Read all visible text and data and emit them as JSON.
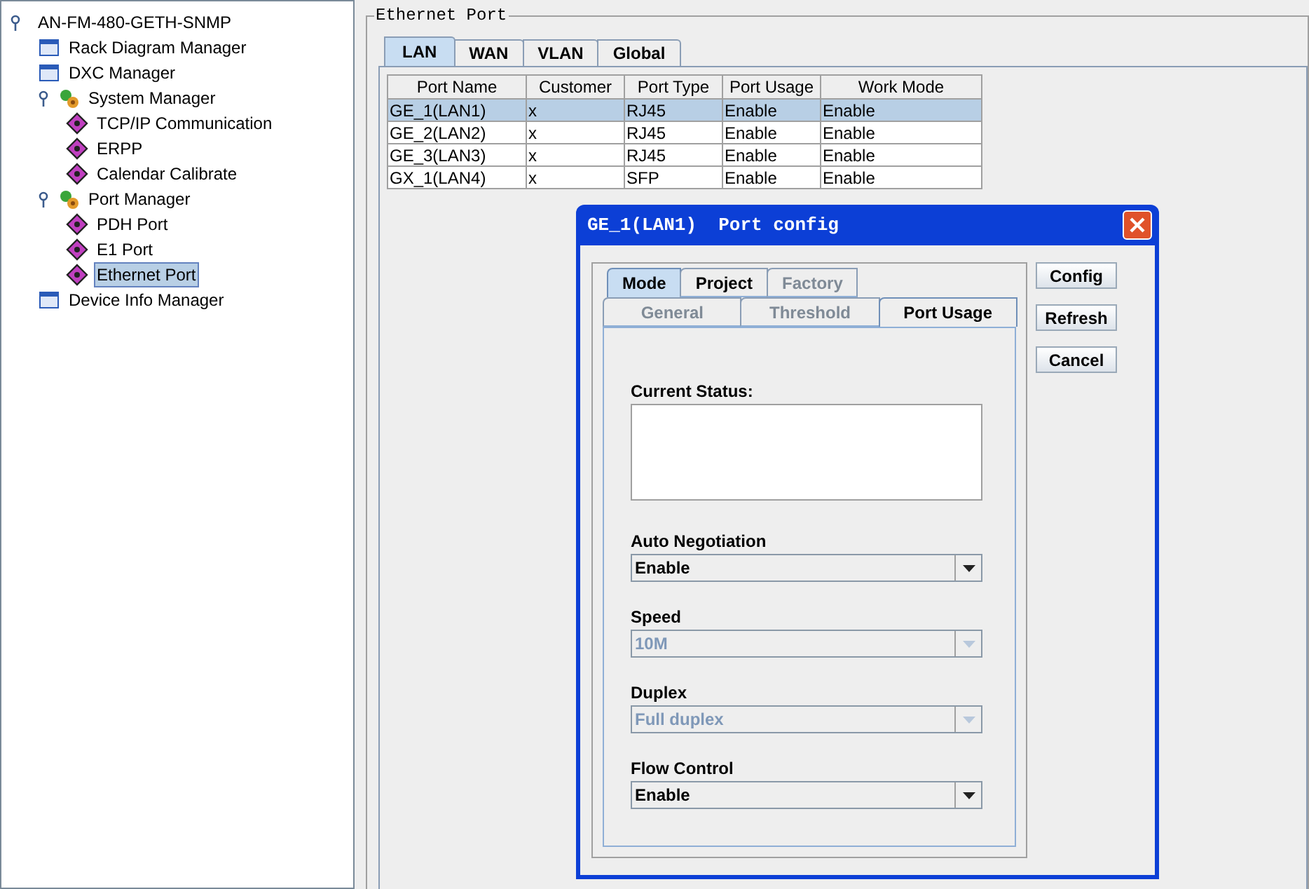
{
  "tree": {
    "label": "AN-FM-480-GETH-SNMP",
    "expanded": true,
    "selected": false,
    "children": [
      {
        "label": "Rack Diagram Manager",
        "selected": false
      },
      {
        "label": "DXC Manager",
        "selected": false
      },
      {
        "label": "System Manager",
        "expanded": true,
        "selected": false,
        "children": [
          {
            "label": "TCP/IP Communication",
            "selected": false
          },
          {
            "label": "ERPP",
            "selected": false
          },
          {
            "label": "Calendar Calibrate",
            "selected": false
          }
        ]
      },
      {
        "label": "Port Manager",
        "expanded": true,
        "selected": false,
        "children": [
          {
            "label": "PDH Port",
            "selected": false
          },
          {
            "label": "E1 Port",
            "selected": false
          },
          {
            "label": "Ethernet Port",
            "selected": true
          }
        ]
      },
      {
        "label": "Device Info Manager",
        "selected": false
      }
    ]
  },
  "panel": {
    "title": "Ethernet Port",
    "tabs": [
      {
        "label": "LAN",
        "selected": true
      },
      {
        "label": "WAN",
        "selected": false
      },
      {
        "label": "VLAN",
        "selected": false
      },
      {
        "label": "Global",
        "selected": false
      }
    ],
    "table": {
      "columns": [
        "Port Name",
        "Customer",
        "Port Type",
        "Port Usage",
        "Work Mode"
      ],
      "rows": [
        {
          "selected": true,
          "cells": [
            "GE_1(LAN1)",
            "x",
            "RJ45",
            "Enable",
            "Enable"
          ]
        },
        {
          "selected": false,
          "cells": [
            "GE_2(LAN2)",
            "x",
            "RJ45",
            "Enable",
            "Enable"
          ]
        },
        {
          "selected": false,
          "cells": [
            "GE_3(LAN3)",
            "x",
            "RJ45",
            "Enable",
            "Enable"
          ]
        },
        {
          "selected": false,
          "cells": [
            "GX_1(LAN4)",
            "x",
            "SFP",
            "Enable",
            "Enable"
          ]
        }
      ]
    }
  },
  "dialog": {
    "title": "GE_1(LAN1)  Port config",
    "tab_rows": [
      [
        {
          "label": "Mode",
          "selected": true,
          "disabled": false
        },
        {
          "label": "Project",
          "selected": false,
          "disabled": false
        },
        {
          "label": "Factory",
          "selected": false,
          "disabled": true
        }
      ],
      [
        {
          "label": "General",
          "selected": false,
          "disabled": true
        },
        {
          "label": "Threshold",
          "selected": false,
          "disabled": true
        },
        {
          "label": "Port Usage",
          "selected": true,
          "disabled": false
        }
      ]
    ],
    "status_label": "Current Status:",
    "fields": [
      {
        "label": "Auto Negotiation",
        "value": "Enable",
        "disabled": false
      },
      {
        "label": "Speed",
        "value": "10M",
        "disabled": true
      },
      {
        "label": "Duplex",
        "value": "Full duplex",
        "disabled": true
      },
      {
        "label": "Flow Control",
        "value": "Enable",
        "disabled": false
      }
    ],
    "buttons": [
      "Config",
      "Refresh",
      "Cancel"
    ]
  }
}
